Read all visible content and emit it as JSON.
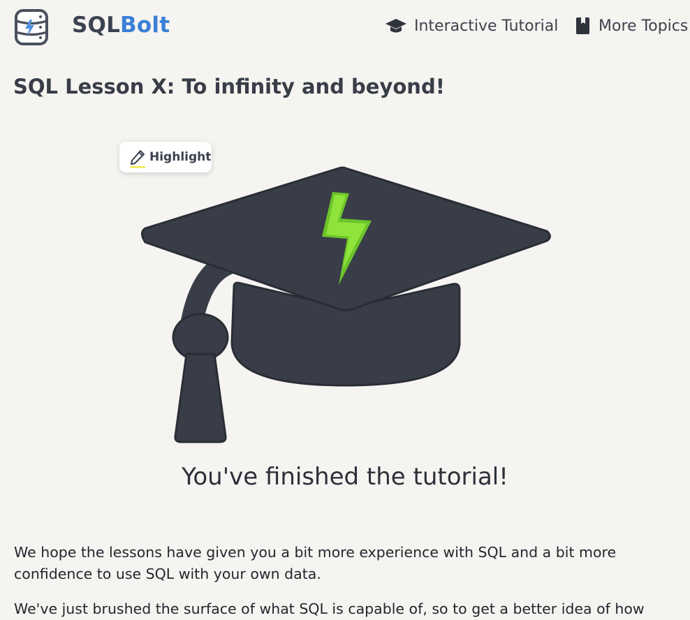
{
  "header": {
    "brand_part1": "SQL",
    "brand_part2": "Bolt",
    "nav": [
      {
        "label": "Interactive Tutorial",
        "icon": "graduation-cap-icon"
      },
      {
        "label": "More Topics",
        "icon": "book-icon"
      }
    ]
  },
  "lesson": {
    "title": "SQL Lesson X: To infinity and beyond!"
  },
  "highlight": {
    "label": "Highlight",
    "icon": "pencil-icon"
  },
  "illustration": {
    "icon": "graduation-cap-bolt-icon",
    "cap_color": "#393d48",
    "bolt_color": "#8fe33a"
  },
  "content": {
    "finished_heading": "You've finished the tutorial!",
    "paragraph1": "We hope the lessons have given you a bit more experience with SQL and a bit more confidence to use SQL with your own data.",
    "paragraph2": "We've just brushed the surface of what SQL is capable of, so to get a better idea of how"
  },
  "colors": {
    "background": "#f5f4f1",
    "brand_blue": "#3b7fd6",
    "brand_dark": "#3b4250"
  }
}
